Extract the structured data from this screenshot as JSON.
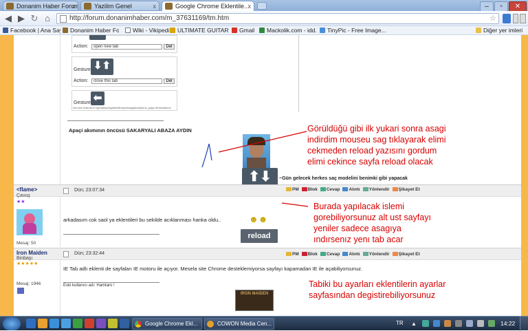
{
  "browser": {
    "tabs": [
      {
        "label": "Donanim Haber Forum",
        "active": false
      },
      {
        "label": "Yazilim Genel",
        "active": false
      },
      {
        "label": "Google Chrome Eklentile...",
        "active": true
      }
    ],
    "close_glyph": "x",
    "address": "http://forum.donanimhaber.com/m_37631169/tm.htm",
    "bookmarks": [
      "Facebook | Ana Sayfa",
      "Donanim Haber For...",
      "Wiki - Vikipedi",
      "ULTIMATE GUITAR ...",
      "Gmail",
      "Mackolik.com - idd...",
      "TinyPic - Free Image..."
    ],
    "other_bookmarks": "Diğer yer imleri"
  },
  "gesture_panel": {
    "action_label": "Action:",
    "gesture_label": "Gesture",
    "delete_label": "Del",
    "rows": [
      {
        "action": "open new tab"
      },
      {
        "action": "close this tab"
      }
    ],
    "footer_note": "chrome-extension://gedabkpiegalaeblifmepdsakgkjkcloptions_page.html#addons"
  },
  "signature": "Apaçi akımının öncüsü SAKARYALI ABAZA AYDIN",
  "avatar_caption": "~Gün gelecek herkes saç modelini benimki gibi yapacak",
  "annotations": {
    "note1": "Görüldüğü gibi ilk yukari sonra asagi indirdim mouseu sag tıklayarak elimi cekmeden reload yazısını gordum elimi cekince sayfa reload olacak",
    "note2": "Burada yapılacak islemi gorebiliyorsunuz alt ust sayfayı yeniler sadece asagıya ındırsenız yenı tab acar",
    "note3": "Tabiki bu ayarları eklentilerin ayarlar sayfasından degistirebiliyorsunuz",
    "reload_label": "reload"
  },
  "post_actions": {
    "pm": "PM",
    "block": "Blok",
    "reply": "Cevap",
    "quote": "Alıntı",
    "redirect": "Yönlendir",
    "report": "Şikayet Et"
  },
  "posts": [
    {
      "user": "<flame>",
      "rank": "Çavuş",
      "date": "Dün; 23:07:34",
      "message": "arkadasım cok saol ya eklentileri bu sekilde acıklanması hanka oldu..",
      "post_count": "Mesaj: 50"
    },
    {
      "user": "Iron Maiden",
      "rank": "Binbaşı",
      "date": "Dün; 23:32:44",
      "message": "IE Tab adlı eklenti de sayfaları IE motoru ile açıyor. Mesela site Chrome desteklemiyorsa sayfayı kapamadan IE ile açabiliyorsunuz.",
      "post_count": "Mesaj: 1946",
      "old_username": "Eski kullanıcı adı: Hamtaro !",
      "banner": "IRON MAIDEN"
    }
  ],
  "taskbar": {
    "items": [
      "Google Chrome Ekl...",
      "COWON Media Cen..."
    ],
    "lang": "TR",
    "time": "14:22"
  }
}
